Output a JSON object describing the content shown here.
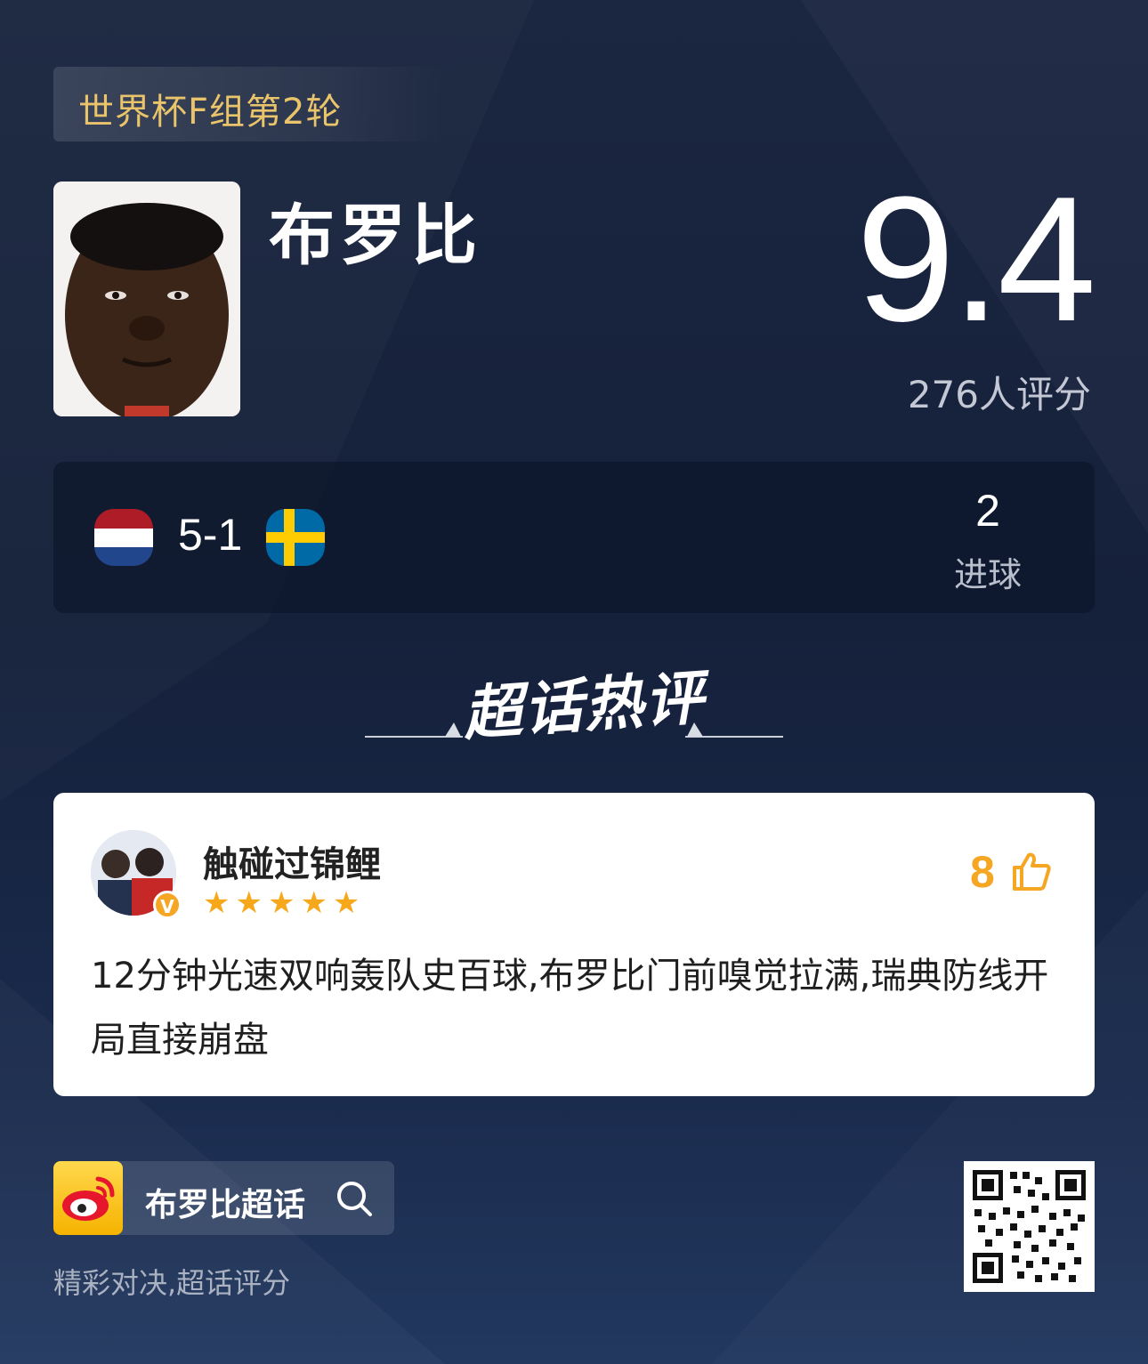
{
  "round_tag": "世界杯F组第2轮",
  "player": {
    "name": "布罗比",
    "rating": "9.4",
    "rating_count": "276人评分"
  },
  "match": {
    "home_flag": "netherlands-flag-icon",
    "away_flag": "sweden-flag-icon",
    "score": "5-1",
    "goals_value": "2",
    "goals_label": "进球"
  },
  "section_title": "超话热评",
  "comment": {
    "user_name": "触碰过锦鲤",
    "verified_mark": "V",
    "stars": "★★★★★",
    "star_rating": 5,
    "likes": "8",
    "text": "12分钟光速双响轰队史百球,布罗比门前嗅觉拉满,瑞典防线开局直接崩盘"
  },
  "footer": {
    "topic_label": "布罗比超话",
    "slogan": "精彩对决,超话评分"
  },
  "colors": {
    "accent_gold": "#e9c46a",
    "like_orange": "#f5a623",
    "star_orange": "#f6a81a"
  }
}
